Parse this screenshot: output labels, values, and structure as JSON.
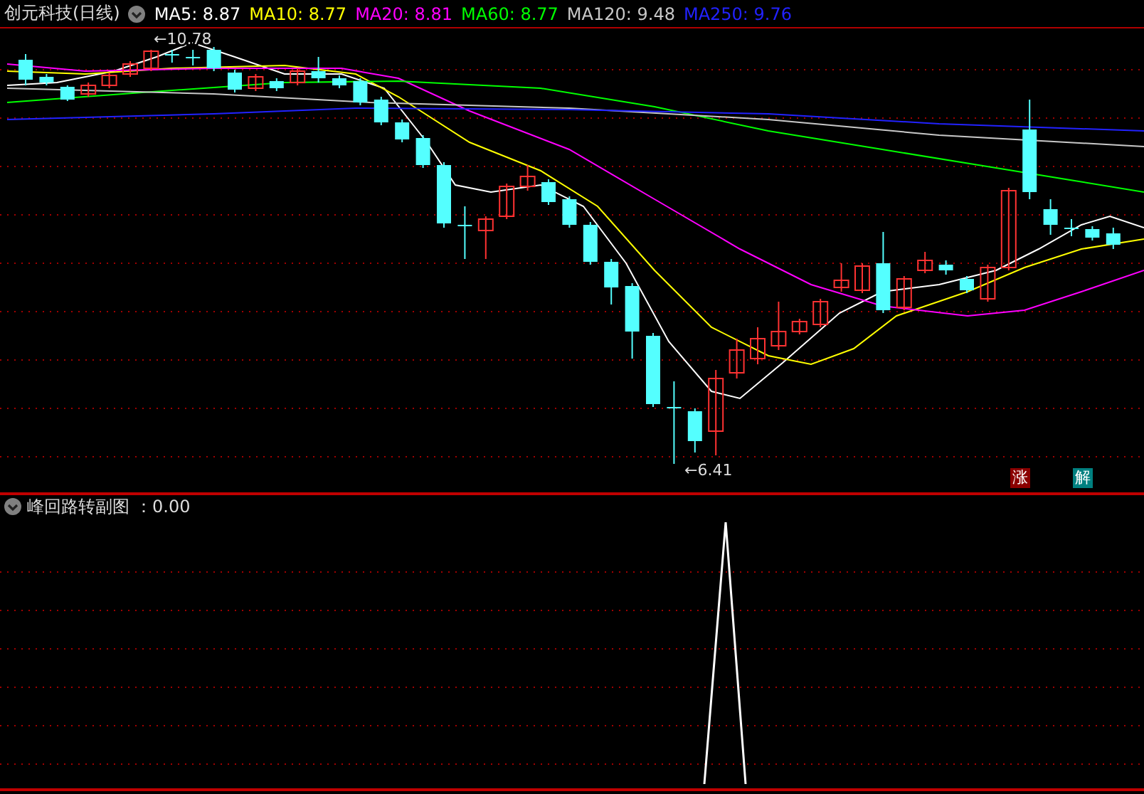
{
  "header": {
    "title": "创元科技(日线)",
    "indicators": [
      {
        "label": "MA5: 8.87",
        "color": "#ffffff"
      },
      {
        "label": "MA10: 8.77",
        "color": "#ffff00"
      },
      {
        "label": "MA20: 8.81",
        "color": "#ff00ff"
      },
      {
        "label": "MA60: 8.77",
        "color": "#00ff00"
      },
      {
        "label": "MA120: 9.48",
        "color": "#c8c8c8"
      },
      {
        "label": "MA250: 9.76",
        "color": "#2222ff"
      }
    ]
  },
  "main_chart": {
    "high_label": "←10.78",
    "low_label": "←6.41",
    "badges": [
      {
        "text": "涨",
        "color": "#8b0000"
      },
      {
        "text": "解",
        "color": "#008080"
      }
    ]
  },
  "sub_chart": {
    "title": "峰回路转副图",
    "value": "：0.00"
  }
}
